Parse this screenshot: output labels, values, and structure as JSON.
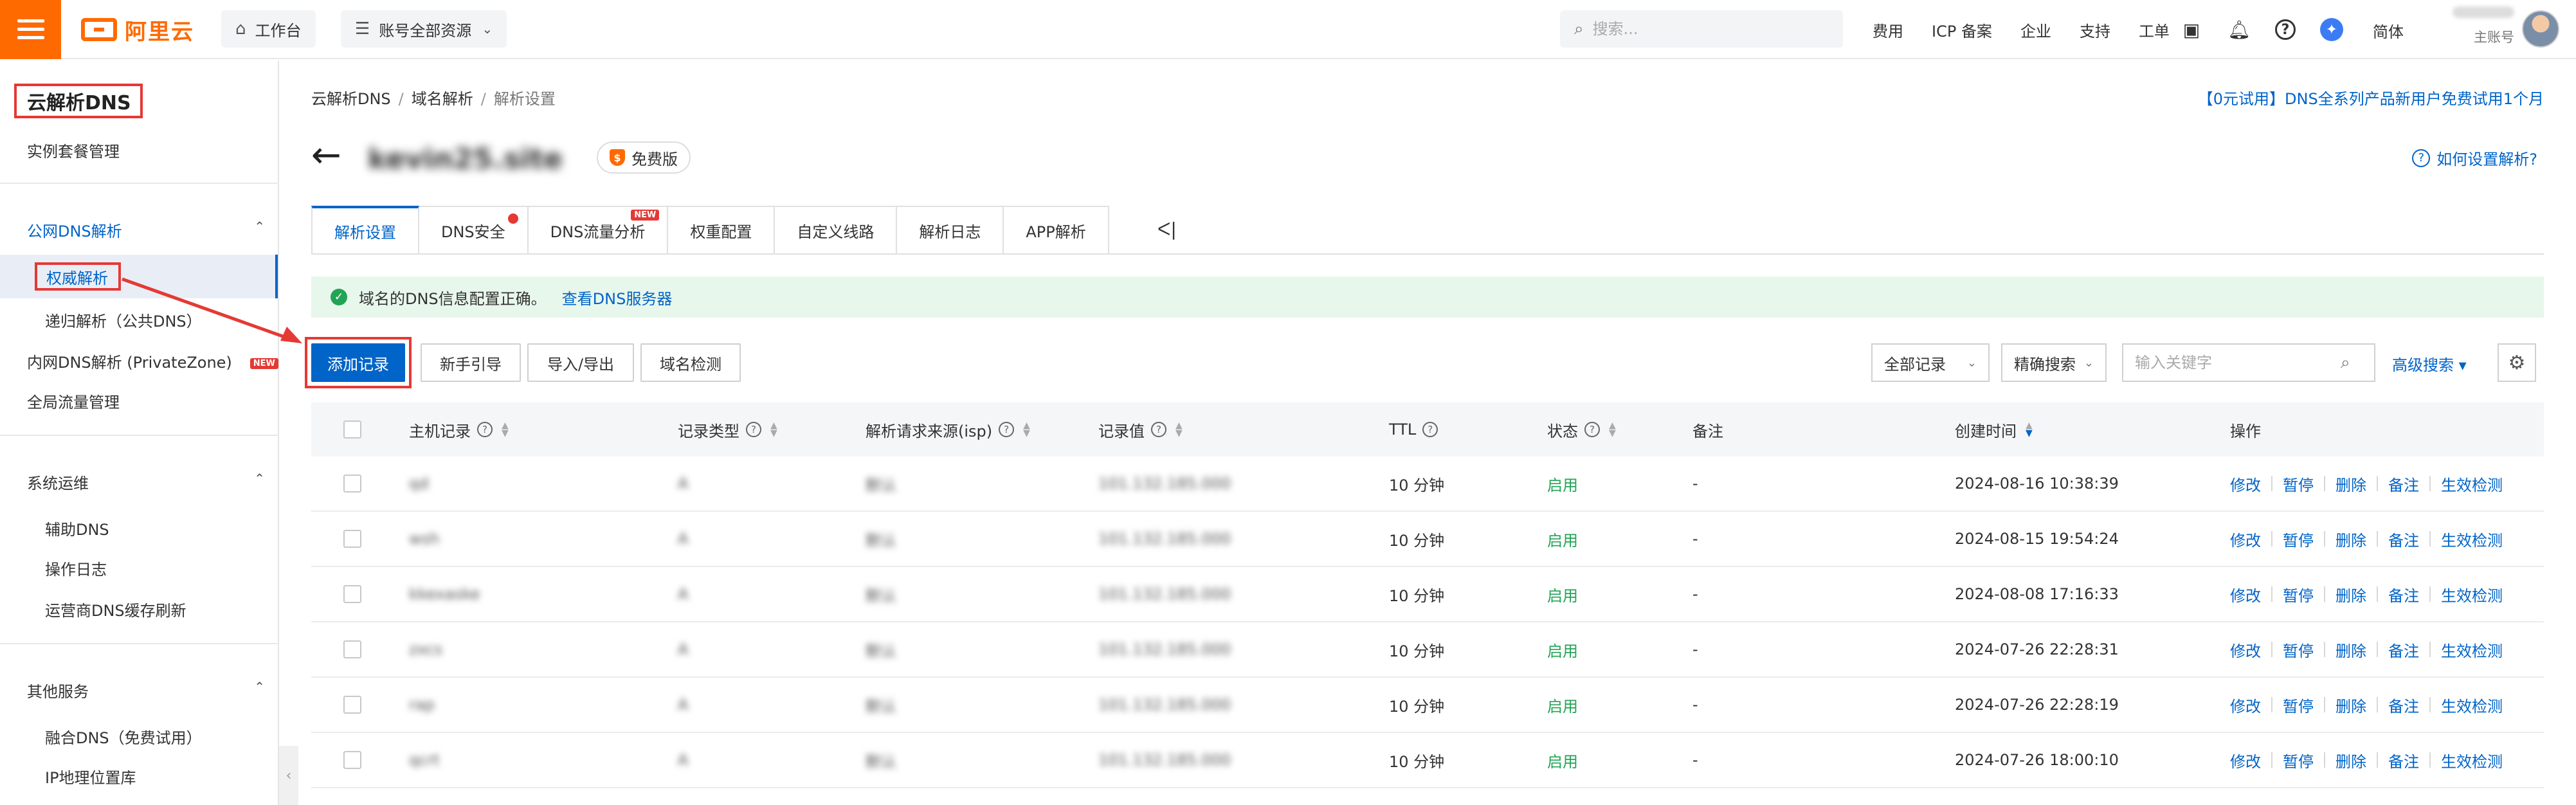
{
  "topbar": {
    "logo_text": "阿里云",
    "workbench_label": "工作台",
    "resources_label": "账号全部资源",
    "search_placeholder": "搜索...",
    "links": [
      "费用",
      "ICP 备案",
      "企业",
      "支持",
      "工单"
    ],
    "icons": [
      "terminal-icon",
      "bell-icon",
      "help-icon",
      "ai-assistant-icon"
    ],
    "language": "简体",
    "account_sub": "主账号"
  },
  "sidebar": {
    "title": "云解析DNS",
    "instance_mgmt": "实例套餐管理",
    "group_public": "公网DNS解析",
    "authoritative": "权威解析",
    "recursive": "递归解析（公共DNS）",
    "intranet": "内网DNS解析 (PrivateZone)",
    "intranet_badge": "NEW",
    "global_traffic": "全局流量管理",
    "group_ops": "系统运维",
    "assist_dns": "辅助DNS",
    "op_log": "操作日志",
    "isp_refresh": "运营商DNS缓存刷新",
    "group_other": "其他服务",
    "fusion_dns": "融合DNS（免费试用）",
    "ip_geo": "IP地理位置库"
  },
  "breadcrumb": [
    "云解析DNS",
    "域名解析",
    "解析设置"
  ],
  "promo_text": "【0元试用】DNS全系列产品新用户免费试用1个月",
  "domain_name": "kevin25.site",
  "edition_badge": "免费版",
  "help_text": "如何设置解析?",
  "tabs": [
    {
      "label": "解析设置",
      "active": true
    },
    {
      "label": "DNS安全",
      "dot": true
    },
    {
      "label": "DNS流量分析",
      "badge": "NEW"
    },
    {
      "label": "权重配置"
    },
    {
      "label": "自定义线路"
    },
    {
      "label": "解析日志"
    },
    {
      "label": "APP解析"
    }
  ],
  "tab_collapse": "ᐸ|",
  "alert": {
    "text": "域名的DNS信息配置正确。",
    "link": "查看DNS服务器"
  },
  "toolbar": {
    "add_record": "添加记录",
    "beginner_guide": "新手引导",
    "import_export": "导入/导出",
    "domain_check": "域名检测",
    "filter_all": "全部记录",
    "search_mode": "精确搜索",
    "keyword_placeholder": "输入关键字",
    "advanced_search": "高级搜索"
  },
  "table": {
    "headers": {
      "host": "主机记录",
      "type": "记录类型",
      "isp": "解析请求来源(isp)",
      "value": "记录值",
      "ttl": "TTL",
      "status": "状态",
      "remark": "备注",
      "created": "创建时间",
      "ops": "操作"
    },
    "rows": [
      {
        "host": "qd",
        "type": "A",
        "isp": "默认",
        "value": "101.132.185.000",
        "ttl": "10 分钟",
        "status": "启用",
        "remark": "-",
        "created": "2024-08-16 10:38:39"
      },
      {
        "host": "wsh",
        "type": "A",
        "isp": "默认",
        "value": "101.132.185.000",
        "ttl": "10 分钟",
        "status": "启用",
        "remark": "-",
        "created": "2024-08-15 19:54:24"
      },
      {
        "host": "kkexaske",
        "type": "A",
        "isp": "默认",
        "value": "101.132.185.000",
        "ttl": "10 分钟",
        "status": "启用",
        "remark": "-",
        "created": "2024-08-08 17:16:33"
      },
      {
        "host": "zxcs",
        "type": "A",
        "isp": "默认",
        "value": "101.132.185.000",
        "ttl": "10 分钟",
        "status": "启用",
        "remark": "-",
        "created": "2024-07-26 22:28:31"
      },
      {
        "host": "rap",
        "type": "A",
        "isp": "默认",
        "value": "101.132.185.000",
        "ttl": "10 分钟",
        "status": "启用",
        "remark": "-",
        "created": "2024-07-26 22:28:19"
      },
      {
        "host": "qcrt",
        "type": "A",
        "isp": "默认",
        "value": "101.132.185.000",
        "ttl": "10 分钟",
        "status": "启用",
        "remark": "-",
        "created": "2024-07-26 18:00:10"
      }
    ],
    "actions": [
      "修改",
      "暂停",
      "删除",
      "备注",
      "生效检测"
    ]
  },
  "colors": {
    "brand": "#ff6a00",
    "primary": "#0064c8",
    "annotation": "#e53935",
    "success": "#23a455"
  }
}
